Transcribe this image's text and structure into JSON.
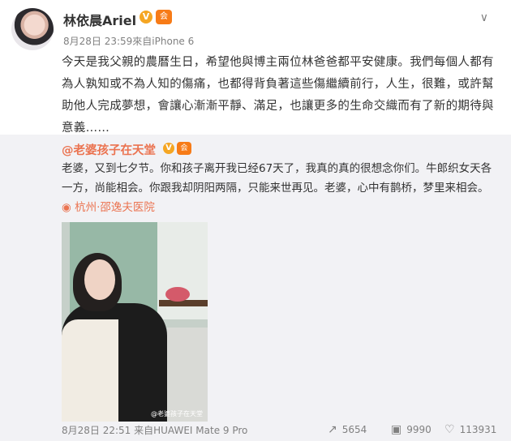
{
  "post": {
    "author": "林依晨Ariel",
    "meta": "8月28日 23:59來自iPhone 6",
    "text": "今天是我父親的農曆生日，希望他與博主兩位林爸爸都平安健康。我們每個人都有為人孰知或不為人知的傷痛，也都得背負著這些傷繼續前行，人生，很難，或許幫助他人完成夢想，會讓心漸漸平靜、滿足，也讓更多的生命交織而有了新的期待與意義……",
    "badge_v": "V",
    "badge_vip": "会"
  },
  "repost": {
    "author": "@老婆孩子在天堂",
    "text": "老婆，又到七夕节。你和孩子离开我已经67天了，我真的真的很想念你们。牛郎织女天各一方，尚能相会。你跟我却阴阳两隔，只能来世再见。老婆，心中有鹊桥，梦里来相会。",
    "location": "杭州·邵逸夫医院",
    "location_icon": "location-pin-icon",
    "photo_watermark": "@老婆孩子在天堂",
    "meta": "8月28日 22:51 来自HUAWEI Mate 9 Pro",
    "reposts": "5654",
    "comments": "9990",
    "likes": "113931"
  },
  "icons": {
    "menu": "chevron-down-icon",
    "repost": "repost-icon",
    "comment": "comment-icon",
    "like": "like-icon"
  },
  "colors": {
    "accent": "#eb7350",
    "repost_bg": "#f2f2f5",
    "meta_text": "#808080"
  }
}
